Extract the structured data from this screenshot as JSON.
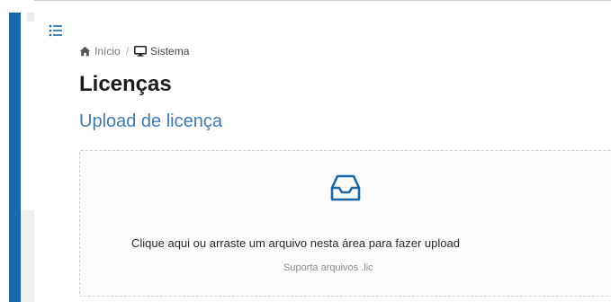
{
  "colors": {
    "accent": "#1a6aa7",
    "section_title": "#3f7bb0",
    "icon_blue": "#1a6aa7"
  },
  "sidebar": {
    "menu_icon": "list-icon"
  },
  "breadcrumb": {
    "home_icon": "home-icon",
    "home_label": "Início",
    "separator": "/",
    "current_icon": "monitor-icon",
    "current_label": "Sistema"
  },
  "page": {
    "title": "Licenças",
    "section_title": "Upload de licença"
  },
  "upload": {
    "icon": "inbox-icon",
    "instruction": "Clique aqui ou arraste um arquivo nesta área para fazer upload",
    "hint": "Suporta arquivos .lic"
  }
}
